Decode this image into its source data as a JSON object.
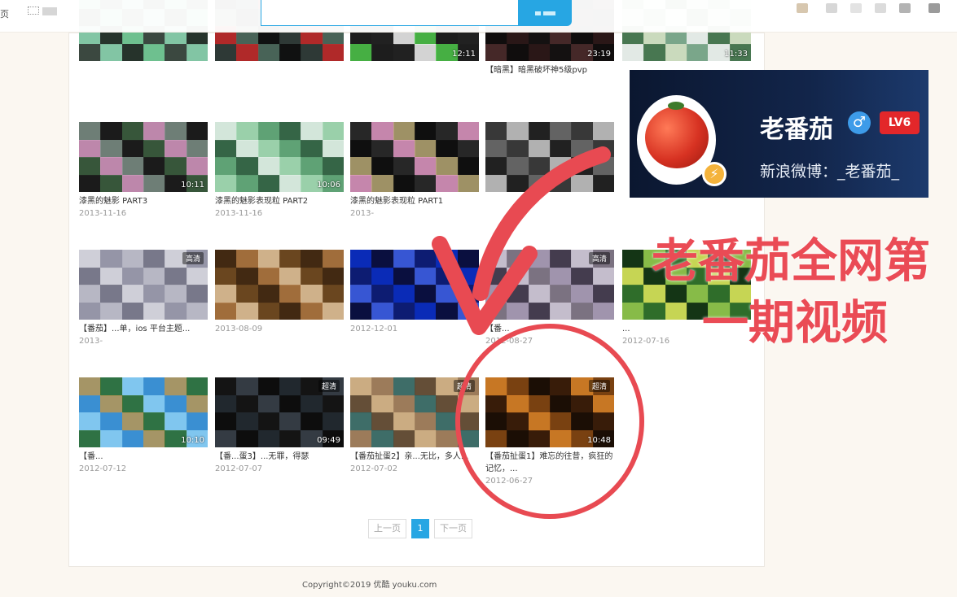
{
  "topbar": {
    "home_label": "页",
    "search_placeholder": ""
  },
  "rows": [
    {
      "cards": [
        {
          "duration": "",
          "title": "",
          "date": "",
          "colors": [
            "#6fbf8f",
            "#1a1a1a",
            "#86c6a8",
            "#333"
          ]
        },
        {
          "duration": "",
          "title": "",
          "date": "",
          "colors": [
            "#2e3a36",
            "#0b0b0b",
            "#4c6b5d",
            "#c72727"
          ]
        },
        {
          "duration": "12:11",
          "title": "",
          "date": "",
          "colors": [
            "#1d1d1d",
            "#4ec94a",
            "#f3f3f3",
            "#222"
          ]
        },
        {
          "duration": "23:19",
          "title": "【暗黑】暗黑破坏神5级pvp",
          "date": "",
          "colors": [
            "#2a1818",
            "#0c0c0c",
            "#4a2b2b",
            "#111"
          ]
        },
        {
          "duration": "11:33",
          "title": "",
          "date": "",
          "colors": [
            "#7aa68a",
            "#d8e3c6",
            "#3f6e46",
            "#f4f4f4"
          ]
        }
      ]
    },
    {
      "cards": [
        {
          "duration": "10:11",
          "title": "漆黑的魅影 PART3",
          "date": "2013-11-16",
          "colors": [
            "#1b1b1b",
            "#7c8f86",
            "#d99ac4",
            "#3c6040"
          ]
        },
        {
          "duration": "10:06",
          "title": "漆黑的魅影表现粒 PART2",
          "date": "2013-11-16",
          "colors": [
            "#5fa276",
            "#a4d8b4",
            "#e8f2ec",
            "#2e5b3e"
          ]
        },
        {
          "duration": "",
          "title": "漆黑的魅影表现粒 PART1",
          "date": "2013-",
          "colors": [
            "#0f0f0f",
            "#b7a874",
            "#e59bc8",
            "#2b2b2b"
          ]
        },
        {
          "duration": "",
          "title": "",
          "date": "",
          "colors": [
            "#383838",
            "#6b6b6b",
            "#1d1d1d",
            "#c7c7c7"
          ]
        }
      ]
    },
    {
      "cards": [
        {
          "duration": "",
          "hd": "高清",
          "title": "【番茄】...单，ios 平台主题...",
          "date": "2013-",
          "colors": [
            "#b7b7c4",
            "#8f8fa2",
            "#d3d3dc",
            "#6d6d80"
          ]
        },
        {
          "duration": "",
          "hd": "",
          "title": "",
          "date": "2013-08-09",
          "colors": [
            "#6a4620",
            "#e1c49e",
            "#a97441",
            "#3b2410"
          ]
        },
        {
          "duration": "",
          "hd": "",
          "title": "",
          "date": "2012-12-01",
          "colors": [
            "#0b2cb7",
            "#0e1a66",
            "#3f5ed8",
            "#0a0a2a"
          ]
        },
        {
          "duration": "",
          "hd": "高清",
          "title": "【番...",
          "date": "2012-08-27",
          "colors": [
            "#7b7281",
            "#d1cad9",
            "#3b3245",
            "#a79ab5"
          ]
        },
        {
          "duration": "",
          "hd": "",
          "title": "...",
          "date": "2012-07-16",
          "colors": [
            "#2f6d2a",
            "#96c94d",
            "#0f2c12",
            "#e0e85c"
          ]
        }
      ]
    },
    {
      "cards": [
        {
          "duration": "10:10",
          "hd": "",
          "title": "【番...",
          "date": "2012-07-12",
          "colors": [
            "#3b8fd2",
            "#8dd0f4",
            "#2e6d2c",
            "#b89654"
          ]
        },
        {
          "duration": "09:49",
          "hd": "超清",
          "title": "【番...蛋3】...无罪，得瑟",
          "date": "2012-07-07",
          "colors": [
            "#141414",
            "#232b33",
            "#0c0c0c",
            "#39424b"
          ]
        },
        {
          "duration": "",
          "hd": "超清",
          "title": "【番茄扯蛋2】亲...无比，多人...",
          "date": "2012-07-02",
          "colors": [
            "#9c7b5a",
            "#d4b58a",
            "#5b4631",
            "#2e6b6b"
          ]
        },
        {
          "duration": "10:48",
          "hd": "超清",
          "title": "【番茄扯蛋1】难忘的往昔，疯狂的记忆，...",
          "date": "2012-06-27",
          "colors": [
            "#1b0e06",
            "#8a4a14",
            "#e58a2a",
            "#3d1e0a"
          ]
        }
      ]
    }
  ],
  "pagination": {
    "prev": "上一页",
    "current": "1",
    "next": "下一页"
  },
  "footer": {
    "copyright": "Copyright©2019 优酷 youku.com"
  },
  "overlay": {
    "name": "老番茄",
    "gender_icon": "♂",
    "level": "LV6",
    "weibo": "新浪微博：_老番茄_",
    "badge_icon": "⚡"
  },
  "annotation": {
    "line1": "老番茄全网第",
    "line2": "一期视频",
    "color": "#ea4b55"
  },
  "colors": {
    "accent": "#27a6e3",
    "annotation_red": "#e84a52"
  }
}
